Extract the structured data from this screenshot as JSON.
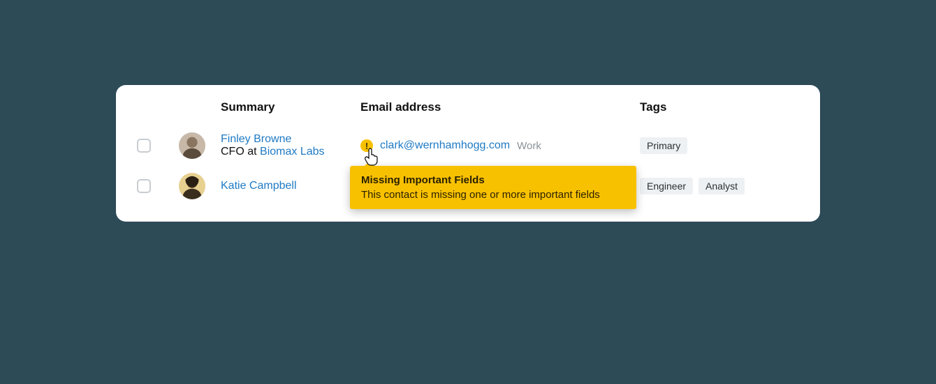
{
  "columns": {
    "summary": "Summary",
    "email": "Email address",
    "tags": "Tags"
  },
  "rows": [
    {
      "name": "Finley Browne",
      "role_prefix": "CFO at ",
      "company": "Biomax Labs",
      "email": "clark@wernhamhogg.com",
      "email_label": "Work",
      "has_warning": true,
      "tags": [
        "Primary"
      ]
    },
    {
      "name": "Katie Campbell",
      "role_prefix": "",
      "company": "",
      "email": "",
      "email_label": "",
      "has_warning": false,
      "tags": [
        "Engineer",
        "Analyst"
      ]
    }
  ],
  "tooltip": {
    "title": "Missing Important Fields",
    "body": "This contact is missing one or more important fields"
  }
}
